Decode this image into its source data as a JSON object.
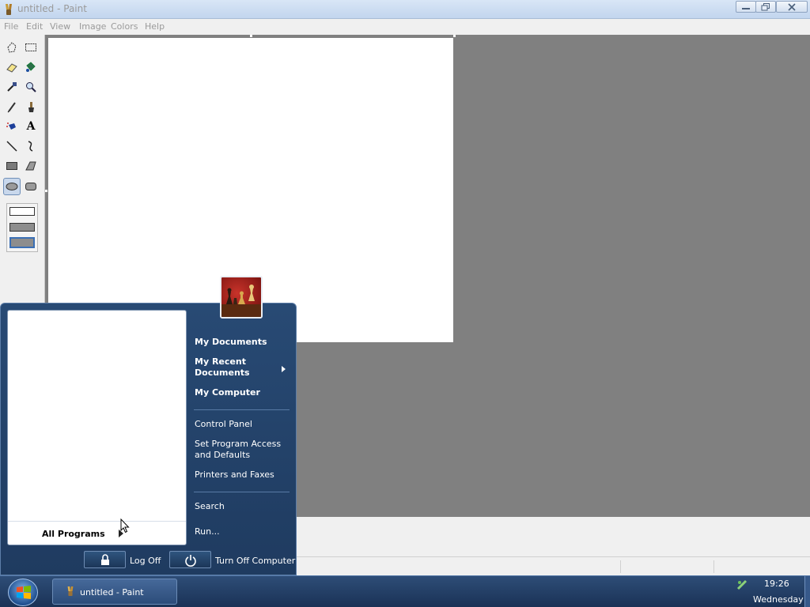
{
  "window": {
    "title": "untitled - Paint"
  },
  "menubar": {
    "items": [
      {
        "label": "File"
      },
      {
        "label": "Edit"
      },
      {
        "label": "View"
      },
      {
        "label": "Image"
      },
      {
        "label": "Colors"
      },
      {
        "label": "Help"
      }
    ]
  },
  "toolbox": {
    "tools": [
      "free-form-select-icon",
      "select-icon",
      "eraser-icon",
      "fill-icon",
      "pick-color-icon",
      "magnifier-icon",
      "pencil-icon",
      "brush-icon",
      "airbrush-icon",
      "text-icon",
      "line-icon",
      "curve-icon",
      "rectangle-icon",
      "polygon-icon",
      "ellipse-icon",
      "rounded-rectangle-icon"
    ],
    "active_tool": "ellipse-icon",
    "text_tool_glyph": "A"
  },
  "start_menu": {
    "all_programs": "All Programs",
    "links": [
      {
        "label": "My Documents"
      },
      {
        "label_line1": "My Recent",
        "label_line2": "Documents"
      },
      {
        "label": "My Computer"
      },
      {
        "label": "Control Panel"
      },
      {
        "label_line1": "Set Program Access",
        "label_line2": "and Defaults"
      },
      {
        "label": "Printers and Faxes"
      },
      {
        "label": "Search"
      },
      {
        "label": "Run..."
      }
    ],
    "log_off": "Log Off",
    "turn_off": "Turn Off Computer"
  },
  "taskbar": {
    "task_label": "untitled - Paint",
    "clock_time": "19:26",
    "clock_day": "Wednesday"
  }
}
